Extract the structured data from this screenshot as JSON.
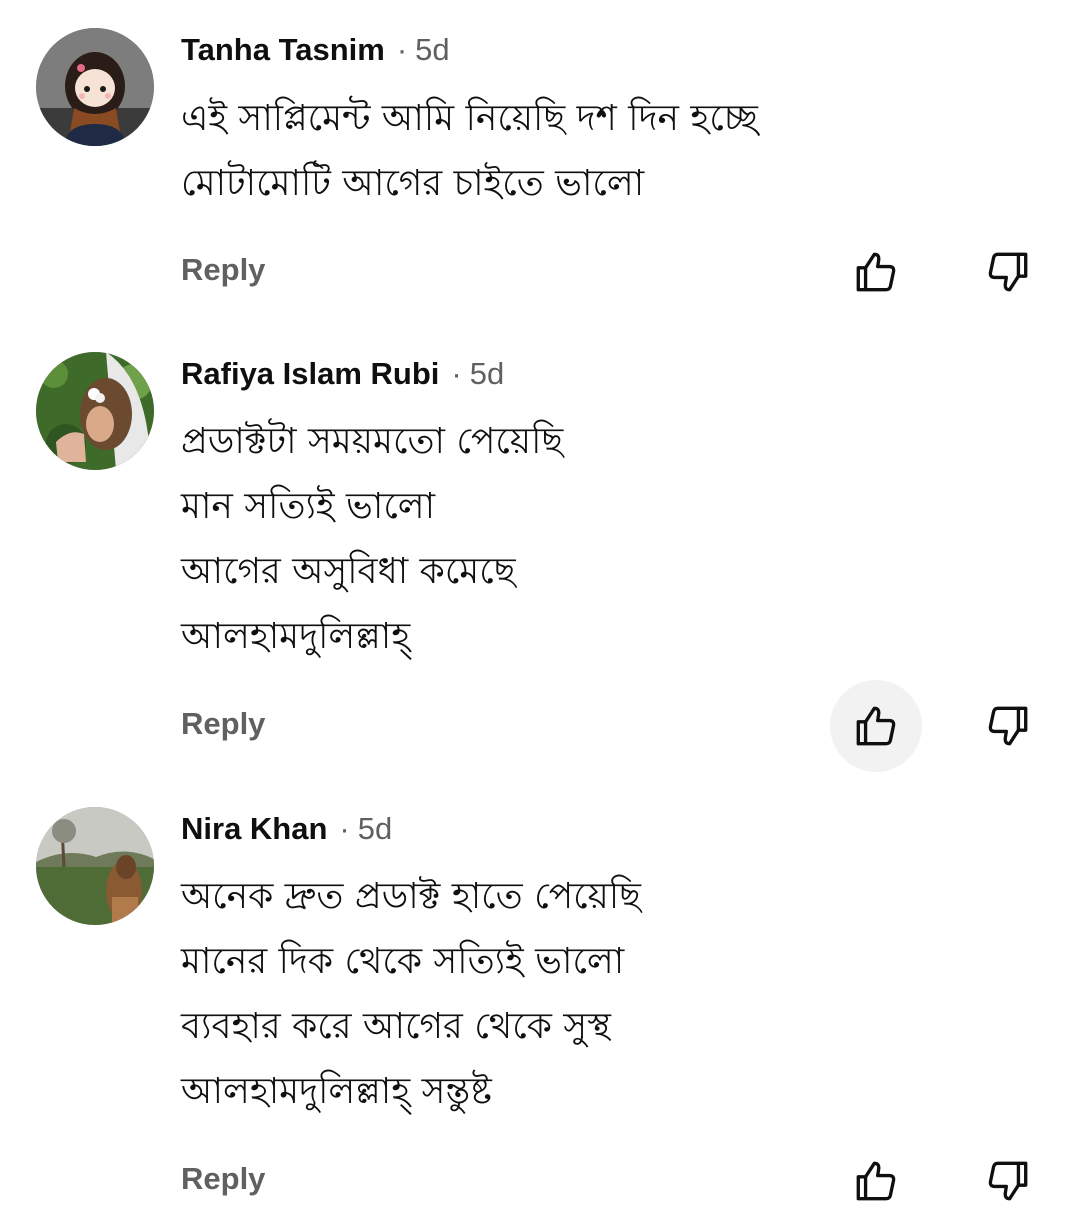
{
  "comments": [
    {
      "author": "Tanha Tasnim",
      "separator": "·",
      "time": "5d",
      "lines": [
        "এই সাপ্লিমেন্ট আমি নিয়েছি দশ দিন হচ্ছে",
        "মোটামোটি আগের চাইতে ভালো"
      ],
      "reply_label": "Reply",
      "avatar_icon": "cartoon-girl-avatar",
      "like_icon": "thumbs-up-icon",
      "dislike_icon": "thumbs-down-icon"
    },
    {
      "author": "Rafiya Islam Rubi",
      "separator": "·",
      "time": "5d",
      "lines": [
        "প্রডাক্টটা সময়মতো পেয়েছি",
        "মান সত্যিই ভালো",
        "আগের অসুবিধা কমেছে",
        "আলহামদুলিল্লাহ্"
      ],
      "reply_label": "Reply",
      "avatar_icon": "photo-avatar-flowers",
      "like_icon": "thumbs-up-icon",
      "dislike_icon": "thumbs-down-icon"
    },
    {
      "author": "Nira Khan",
      "separator": "·",
      "time": "5d",
      "lines": [
        "অনেক দ্রুত প্রডাক্ট হাতে পেয়েছি",
        "মানের দিক থেকে সত্যিই ভালো",
        "ব্যবহার করে আগের থেকে সুস্থ",
        "আলহামদুলিল্লাহ্ সন্তুষ্ট"
      ],
      "reply_label": "Reply",
      "avatar_icon": "photo-avatar-field",
      "like_icon": "thumbs-up-icon",
      "dislike_icon": "thumbs-down-icon"
    }
  ],
  "colors": {
    "author_text": "#0f0f0f",
    "meta_text": "#606060",
    "pressed_bg": "#f2f2f2",
    "background": "#ffffff"
  }
}
